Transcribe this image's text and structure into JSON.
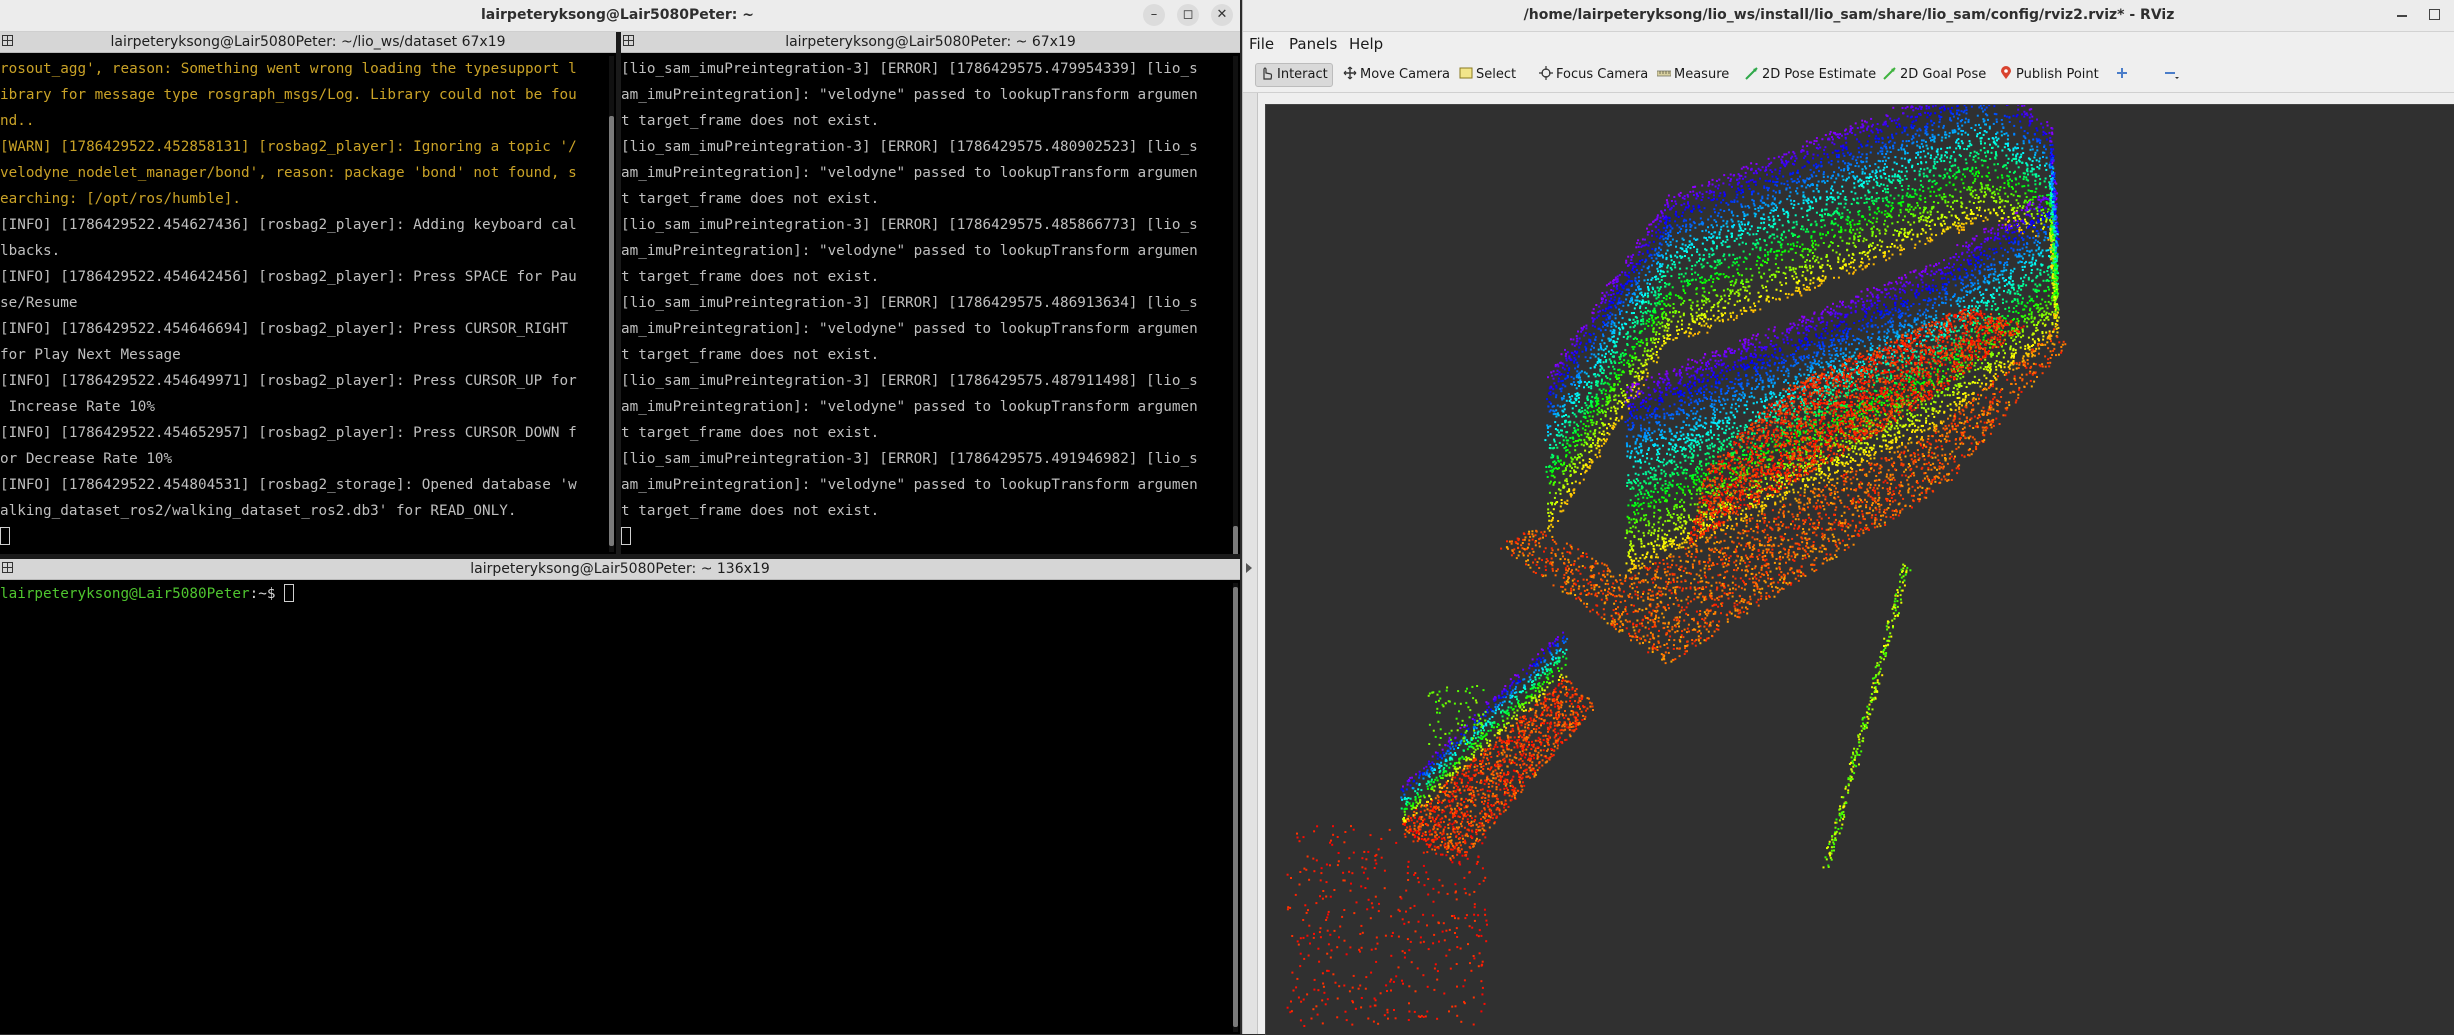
{
  "terminator": {
    "window_title": "lairpeteryksong@Lair5080Peter: ~",
    "pane_top_left": {
      "title": "lairpeteryksong@Lair5080Peter: ~/lio_ws/dataset 67x19",
      "lines": [
        {
          "text": "rosout_agg', reason: Something went wrong loading the typesupport l",
          "kind": "warn"
        },
        {
          "text": "ibrary for message type rosgraph_msgs/Log. Library could not be fou",
          "kind": "warn"
        },
        {
          "text": "nd..",
          "kind": "warn"
        },
        {
          "text": "[WARN] [1786429522.452858131] [rosbag2_player]: Ignoring a topic '/",
          "kind": "warn"
        },
        {
          "text": "velodyne_nodelet_manager/bond', reason: package 'bond' not found, s",
          "kind": "warn"
        },
        {
          "text": "earching: [/opt/ros/humble].",
          "kind": "warn"
        },
        {
          "text": "[INFO] [1786429522.454627436] [rosbag2_player]: Adding keyboard cal",
          "kind": "info"
        },
        {
          "text": "lbacks.",
          "kind": "info"
        },
        {
          "text": "[INFO] [1786429522.454642456] [rosbag2_player]: Press SPACE for Pau",
          "kind": "info"
        },
        {
          "text": "se/Resume",
          "kind": "info"
        },
        {
          "text": "[INFO] [1786429522.454646694] [rosbag2_player]: Press CURSOR_RIGHT",
          "kind": "info"
        },
        {
          "text": "for Play Next Message",
          "kind": "info"
        },
        {
          "text": "[INFO] [1786429522.454649971] [rosbag2_player]: Press CURSOR_UP for",
          "kind": "info"
        },
        {
          "text": " Increase Rate 10%",
          "kind": "info"
        },
        {
          "text": "[INFO] [1786429522.454652957] [rosbag2_player]: Press CURSOR_DOWN f",
          "kind": "info"
        },
        {
          "text": "or Decrease Rate 10%",
          "kind": "info"
        },
        {
          "text": "[INFO] [1786429522.454804531] [rosbag2_storage]: Opened database 'w",
          "kind": "info"
        },
        {
          "text": "alking_dataset_ros2/walking_dataset_ros2.db3' for READ_ONLY.",
          "kind": "info"
        }
      ]
    },
    "pane_top_right": {
      "title": "lairpeteryksong@Lair5080Peter: ~ 67x19",
      "lines": [
        "[lio_sam_imuPreintegration-3] [ERROR] [1786429575.479954339] [lio_s",
        "am_imuPreintegration]: \"velodyne\" passed to lookupTransform argumen",
        "t target_frame does not exist.",
        "[lio_sam_imuPreintegration-3] [ERROR] [1786429575.480902523] [lio_s",
        "am_imuPreintegration]: \"velodyne\" passed to lookupTransform argumen",
        "t target_frame does not exist.",
        "[lio_sam_imuPreintegration-3] [ERROR] [1786429575.485866773] [lio_s",
        "am_imuPreintegration]: \"velodyne\" passed to lookupTransform argumen",
        "t target_frame does not exist.",
        "[lio_sam_imuPreintegration-3] [ERROR] [1786429575.486913634] [lio_s",
        "am_imuPreintegration]: \"velodyne\" passed to lookupTransform argumen",
        "t target_frame does not exist.",
        "[lio_sam_imuPreintegration-3] [ERROR] [1786429575.487911498] [lio_s",
        "am_imuPreintegration]: \"velodyne\" passed to lookupTransform argumen",
        "t target_frame does not exist.",
        "[lio_sam_imuPreintegration-3] [ERROR] [1786429575.491946982] [lio_s",
        "am_imuPreintegration]: \"velodyne\" passed to lookupTransform argumen",
        "t target_frame does not exist."
      ]
    },
    "pane_bottom": {
      "title": "lairpeteryksong@Lair5080Peter: ~ 136x19",
      "prompt_user": "lairpeteryksong@Lair5080Peter",
      "prompt_symbol": ":~$"
    },
    "buttons": {
      "minimize": "–",
      "maximize": "◻",
      "close": "✕"
    }
  },
  "rviz": {
    "window_title": "/home/lairpeteryksong/lio_ws/install/lio_sam/share/lio_sam/config/rviz2.rviz* - RViz",
    "menu": [
      "File",
      "Panels",
      "Help"
    ],
    "tools": [
      {
        "label": "Interact",
        "icon": "interact-icon",
        "active": true
      },
      {
        "label": "Move Camera",
        "icon": "move-camera-icon",
        "active": false
      },
      {
        "label": "Select",
        "icon": "select-icon",
        "active": false
      },
      {
        "label": "Focus Camera",
        "icon": "focus-camera-icon",
        "active": false
      },
      {
        "label": "Measure",
        "icon": "measure-icon",
        "active": false
      },
      {
        "label": "2D Pose Estimate",
        "icon": "pose-estimate-icon",
        "active": false
      },
      {
        "label": "2D Goal Pose",
        "icon": "goal-pose-icon",
        "active": false
      },
      {
        "label": "Publish Point",
        "icon": "publish-point-icon",
        "active": false
      }
    ],
    "colors": {
      "background": "#303030",
      "accent": "#4a7dc9"
    }
  }
}
